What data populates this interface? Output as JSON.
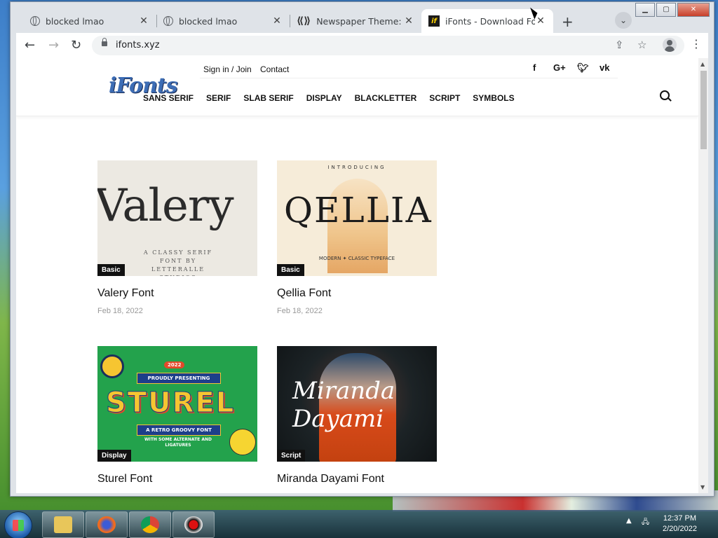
{
  "browser": {
    "tabs": [
      {
        "title": "blocked lmao",
        "icon": "globe-icon"
      },
      {
        "title": "blocked lmao",
        "icon": "globe-icon"
      },
      {
        "title": "Newspaper Theme: Cha",
        "icon": "newspaper-icon"
      },
      {
        "title": "iFonts - Download Font",
        "icon": "ifonts-favicon"
      }
    ],
    "url": "ifonts.xyz"
  },
  "site": {
    "logo_text": "iFonts",
    "top_links": [
      "Sign in / Join",
      "Contact"
    ],
    "social": [
      "f",
      "G+",
      "twitter",
      "vk"
    ],
    "menu": [
      "SANS SERIF",
      "SERIF",
      "SLAB SERIF",
      "DISPLAY",
      "BLACKLETTER",
      "SCRIPT",
      "SYMBOLS"
    ]
  },
  "posts": [
    {
      "title": "Valery Font",
      "date": "Feb 18, 2022",
      "category": "Basic",
      "thumb_text": "Valery",
      "thumb_sub": "A CLASSY SERIF FONT BY LETTERALLE STUDIOS"
    },
    {
      "title": "Qellia Font",
      "date": "Feb 18, 2022",
      "category": "Basic",
      "thumb_text": "QELLIA",
      "thumb_intro": "INTRODUCING",
      "thumb_sub": "MODERN ✦ CLASSIC TYPEFACE"
    },
    {
      "title": "Sturel Font",
      "date": "",
      "category": "Display",
      "thumb_text": "STUREL",
      "thumb_year": "2022",
      "thumb_top": "PROUDLY PRESENTING",
      "thumb_mid": "A RETRO GROOVY FONT",
      "thumb_sub": "WITH SOME ALTERNATE AND LIGATURES"
    },
    {
      "title": "Miranda Dayami Font",
      "date": "",
      "category": "Script",
      "thumb_text": "Miranda Dayami"
    }
  ],
  "taskbar": {
    "time": "12:37 PM",
    "date": "2/20/2022"
  },
  "colors": {
    "accent": "#3d6db5",
    "badge": "#111111"
  }
}
